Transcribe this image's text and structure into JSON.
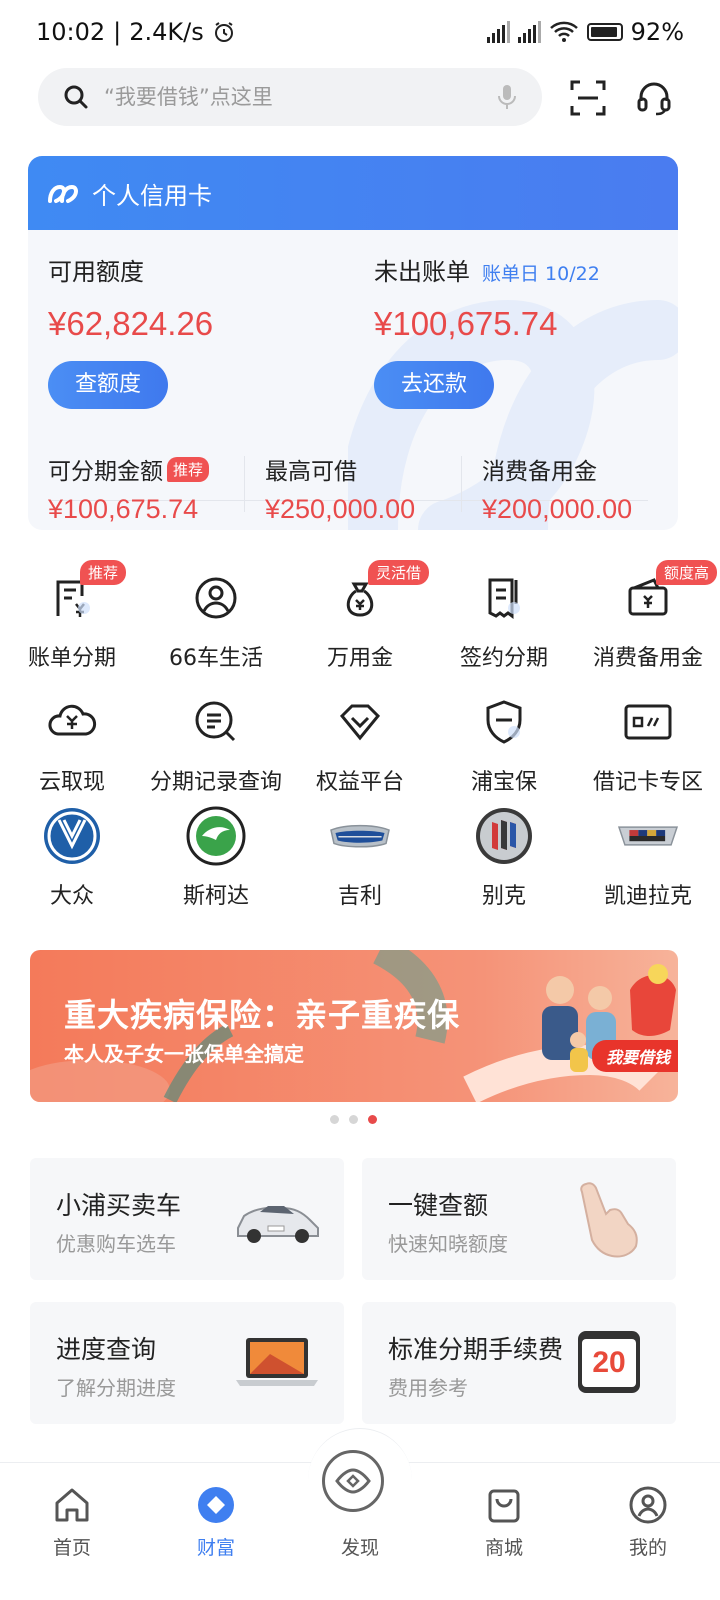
{
  "status_bar": {
    "time": "10:02",
    "speed": "2.4K/s",
    "battery": "92%"
  },
  "search": {
    "placeholder": "“我要借钱”点这里"
  },
  "card": {
    "title": "个人信用卡",
    "available_label": "可用额度",
    "available_amount": "¥62,824.26",
    "check_button": "查额度",
    "bill_label": "未出账单",
    "bill_day": "账单日 10/22",
    "bill_amount": "¥100,675.74",
    "repay_button": "去还款",
    "installment_label": "可分期金额",
    "installment_tag": "推荐",
    "installment_amount": "¥100,675.74",
    "max_borrow_label": "最高可借",
    "max_borrow_amount": "¥250,000.00",
    "reserve_label": "消费备用金",
    "reserve_amount": "¥200,000.00"
  },
  "grid_row1": [
    {
      "label": "账单分期",
      "tag": "推荐",
      "icon": "bill-installment-icon"
    },
    {
      "label": "66车生活",
      "tag": "",
      "icon": "car-life-icon"
    },
    {
      "label": "万用金",
      "tag": "灵活借",
      "icon": "money-bag-icon"
    },
    {
      "label": "签约分期",
      "tag": "",
      "icon": "contract-icon"
    },
    {
      "label": "消费备用金",
      "tag": "额度高",
      "icon": "wallet-icon"
    }
  ],
  "grid_row2": [
    {
      "label": "云取现",
      "icon": "cloud-cash-icon"
    },
    {
      "label": "分期记录查询",
      "icon": "record-search-icon"
    },
    {
      "label": "权益平台",
      "icon": "diamond-icon"
    },
    {
      "label": "浦宝保",
      "icon": "shield-icon"
    },
    {
      "label": "借记卡专区",
      "icon": "debit-card-icon"
    }
  ],
  "grid_row3": [
    {
      "label": "大众",
      "icon": "volkswagen-logo-icon"
    },
    {
      "label": "斯柯达",
      "icon": "skoda-logo-icon"
    },
    {
      "label": "吉利",
      "icon": "geely-logo-icon"
    },
    {
      "label": "别克",
      "icon": "buick-logo-icon"
    },
    {
      "label": "凯迪拉克",
      "icon": "cadillac-logo-icon"
    }
  ],
  "banner": {
    "title": "重大疾病保险：亲子重疾保",
    "subtitle": "本人及子女一张保单全搞定",
    "cta": "我要借钱"
  },
  "features": [
    {
      "title": "小浦买卖车",
      "sub": "优惠购车选车"
    },
    {
      "title": "一键查额",
      "sub": "快速知晓额度"
    },
    {
      "title": "进度查询",
      "sub": "了解分期进度"
    },
    {
      "title": "标准分期手续费",
      "sub": "费用参考",
      "badge": "20"
    }
  ],
  "nav": [
    {
      "label": "首页"
    },
    {
      "label": "财富"
    },
    {
      "label": "发现"
    },
    {
      "label": "商城"
    },
    {
      "label": "我的"
    }
  ],
  "colors": {
    "accent": "#3f7ff0",
    "amount_red": "#e84a4a",
    "tag_red": "#f05252"
  }
}
